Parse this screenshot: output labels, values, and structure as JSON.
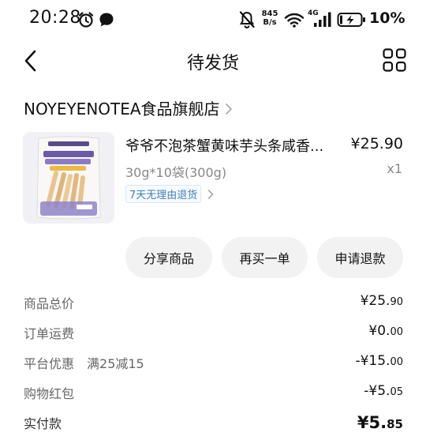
{
  "status_bar": {
    "time": "20:28",
    "network_speed_value": "845",
    "network_speed_unit": "B/s",
    "signal_label": "4G",
    "battery_percent": "10%",
    "icons": [
      "alarm-icon",
      "chat-bubble-icon",
      "mute-bell-icon",
      "wifi-icon",
      "cellular-signal-icon",
      "battery-charging-icon"
    ]
  },
  "nav": {
    "title": "待发货",
    "back_icon": "back-arrow-icon",
    "menu_icon": "grid-menu-icon"
  },
  "store": {
    "name": "NOYEYENOTEA食品旗舰店"
  },
  "product": {
    "title": "爷爷不泡茶蟹黄味芋头条咸香...",
    "price": "¥25.90",
    "spec": "30g*10袋(300g)",
    "quantity": "x1",
    "return_tag": "7天无理由退货"
  },
  "actions": {
    "share": "分享商品",
    "rebuy": "再买一单",
    "refund": "申请退款"
  },
  "summary": {
    "goods_total_label": "商品总价",
    "goods_total_value_main": "¥25.",
    "goods_total_value_small": "90",
    "shipping_label": "订单运费",
    "shipping_value_main": "¥0.",
    "shipping_value_small": "00",
    "platform_discount_label": "平台优惠",
    "platform_discount_desc": "满25减15",
    "platform_discount_value_main": "-¥15.",
    "platform_discount_value_small": "00",
    "red_packet_label": "购物红包",
    "red_packet_value_main": "-¥5.",
    "red_packet_value_small": "05",
    "paid_label": "实付款",
    "paid_value_main": "¥5.",
    "paid_value_small": "85"
  },
  "colors": {
    "button_bg": "#f2f2f2",
    "tag_text": "#3f7fb8",
    "tag_border": "#d8e7f4",
    "muted_text": "#888888"
  }
}
